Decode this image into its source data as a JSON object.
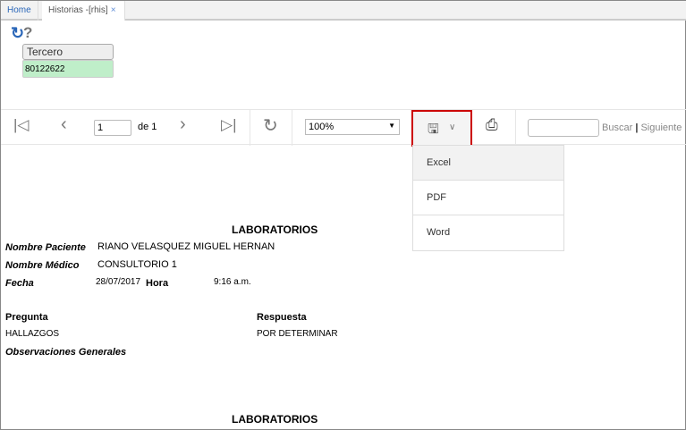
{
  "tabs": [
    {
      "label": "Home"
    },
    {
      "label": "Historias -[rhis]",
      "close": "×"
    }
  ],
  "top_icons": {
    "refresh": "refresh-icon",
    "help": "?"
  },
  "tercero": {
    "label": "Tercero",
    "value": "80122622"
  },
  "toolbar": {
    "page": "1",
    "of": "de 1",
    "zoom": "100%",
    "buscar": "Buscar",
    "sep": "|",
    "siguiente": "Siguiente"
  },
  "export_menu": [
    "Excel",
    "PDF",
    "Word"
  ],
  "report": {
    "title": "LABORATORIOS",
    "paciente_label": "Nombre Paciente",
    "paciente": "RIANO VELASQUEZ MIGUEL HERNAN",
    "medico_label": "Nombre Médico",
    "medico": "CONSULTORIO 1",
    "fecha_label": "Fecha",
    "fecha": "28/07/2017",
    "hora_label": "Hora",
    "hora": "9:16 a.m.",
    "pregunta_label": "Pregunta",
    "respuesta_label": "Respuesta",
    "pregunta": "HALLAZGOS",
    "respuesta": "POR DETERMINAR",
    "obs_label": "Observaciones Generales",
    "title2": "LABORATORIOS"
  }
}
